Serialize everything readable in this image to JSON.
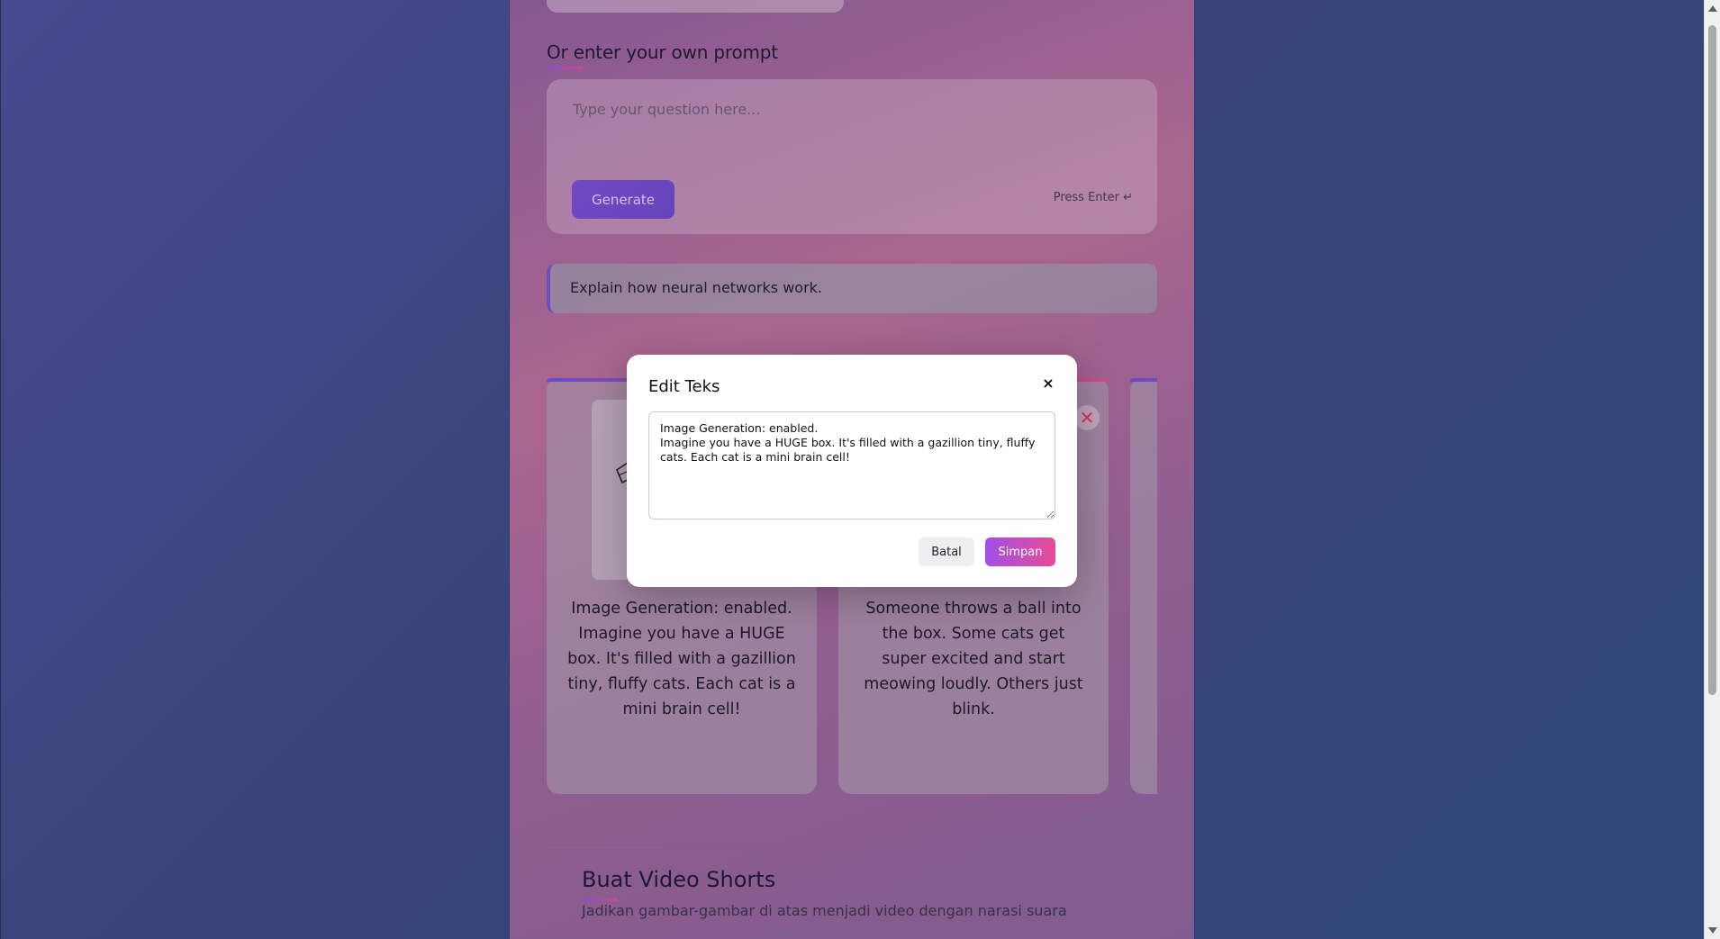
{
  "prompt_section": {
    "title": "Or enter your own prompt",
    "placeholder": "Type your question here...",
    "generate_label": "Generate",
    "press_enter_label": "Press Enter ↵"
  },
  "selected_example": "Explain how neural networks work.",
  "scenes": [
    {
      "text": "Image Generation: enabled. Imagine you have a HUGE box. It's filled with a gazillion tiny, fluffy cats. Each cat is a mini brain cell!"
    },
    {
      "text": "Someone throws a ball into the box. Some cats get super excited and start meowing loudly. Others just blink."
    }
  ],
  "delete_icon": "close-x-icon",
  "video_section": {
    "title": "Buat Video Shorts",
    "subtitle": "Jadikan gambar-gambar di atas menjadi video dengan narasi suara"
  },
  "modal": {
    "title": "Edit Teks",
    "close_label": "×",
    "text_value": "Image Generation: enabled.\nImagine you have a HUGE box. It's filled with a gazillion tiny, fluffy cats. Each cat is a mini brain cell!",
    "cancel_label": "Batal",
    "save_label": "Simpan"
  },
  "colors": {
    "accent_purple": "#7a4cd0",
    "accent_pink": "#e84c94",
    "delete_red": "#e0325c"
  }
}
